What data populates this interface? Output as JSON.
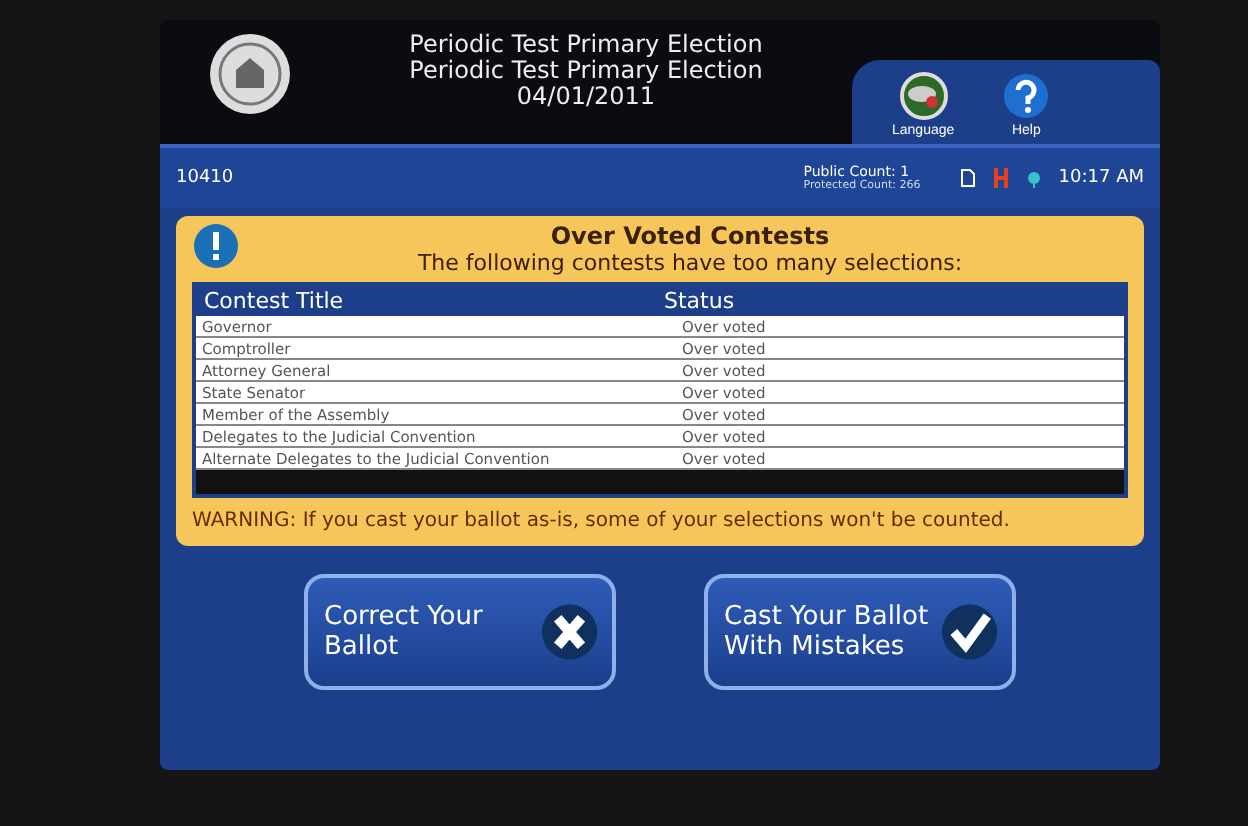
{
  "header": {
    "titles": [
      "Periodic Test Primary Election",
      "Periodic Test Primary Election",
      "04/01/2011"
    ],
    "tools": [
      {
        "kind": "language",
        "label": "Language"
      },
      {
        "kind": "help",
        "label": "Help"
      }
    ]
  },
  "status_bar": {
    "code": "10410",
    "public_count": "Public Count: 1",
    "protected_count": "Protected Count: 266",
    "time": "10:17 AM"
  },
  "dialog": {
    "title": "Over Voted Contests",
    "subtitle": "The following contests have too many selections:",
    "table": {
      "columns": [
        "Contest Title",
        "Status"
      ],
      "rows": [
        [
          "Governor",
          "Over voted"
        ],
        [
          "Comptroller",
          "Over voted"
        ],
        [
          "Attorney General",
          "Over voted"
        ],
        [
          "State Senator",
          "Over voted"
        ],
        [
          "Member of the Assembly",
          "Over voted"
        ],
        [
          "Delegates to the Judicial Convention",
          "Over voted"
        ],
        [
          "Alternate Delegates to the Judicial Convention",
          "Over voted"
        ]
      ]
    },
    "warning": "WARNING: If you cast your ballot as-is, some of your selections won't be counted."
  },
  "buttons": [
    {
      "kind": "correct",
      "label": "Correct Your Ballot"
    },
    {
      "kind": "cast",
      "label": "Cast Your Ballot With Mistakes"
    }
  ]
}
